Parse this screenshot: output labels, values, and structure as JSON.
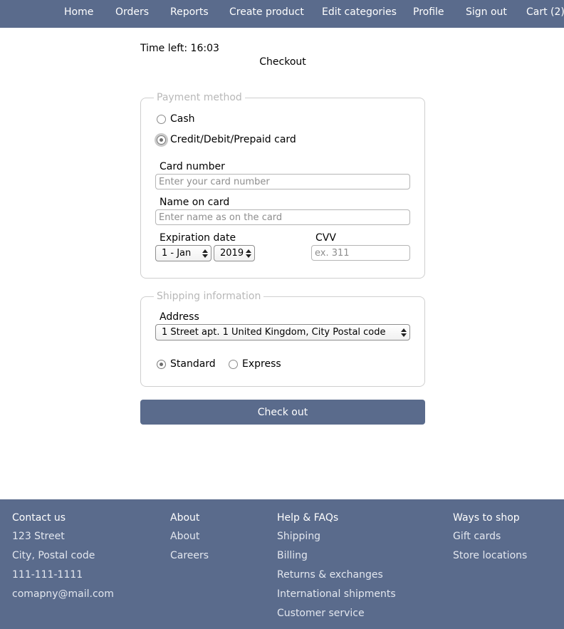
{
  "nav": {
    "items": [
      "Home",
      "Orders",
      "Reports",
      "Create product",
      "Edit categories",
      "Profile",
      "Sign out",
      "Cart (2)"
    ]
  },
  "timer": "Time left: 16:03",
  "page_title": "Checkout",
  "payment": {
    "legend": "Payment method",
    "options": [
      "Cash",
      "Credit/Debit/Prepaid card"
    ],
    "selected": "Credit/Debit/Prepaid card",
    "card_number_label": "Card number",
    "card_number_placeholder": "Enter your card number",
    "name_label": "Name on card",
    "name_placeholder": "Enter name as on the card",
    "expiration_label": "Expiration date",
    "month_value": "1 - Jan",
    "year_value": "2019",
    "cvv_label": "CVV",
    "cvv_placeholder": "ex. 311"
  },
  "shipping": {
    "legend": "Shipping information",
    "address_label": "Address",
    "address_value": "1 Street apt. 1 United Kingdom, City Postal code",
    "options": [
      "Standard",
      "Express"
    ],
    "selected": "Standard"
  },
  "checkout_button": "Check out",
  "footer": {
    "contact": {
      "heading": "Contact us",
      "items": [
        "123 Street",
        "City, Postal code",
        "111-111-1111",
        "comapny@mail.com"
      ]
    },
    "about": {
      "heading": "About",
      "items": [
        "About",
        "Careers"
      ]
    },
    "help": {
      "heading": "Help & FAQs",
      "items": [
        "Shipping",
        "Billing",
        "Returns & exchanges",
        "International shipments",
        "Customer service"
      ]
    },
    "ways": {
      "heading": "Ways to shop",
      "items": [
        "Gift cards",
        "Store locations"
      ]
    }
  },
  "colors": {
    "nav_background": "#5a6b8c",
    "button_background": "#5a6b8c",
    "footer_background": "#5a6b8c"
  }
}
